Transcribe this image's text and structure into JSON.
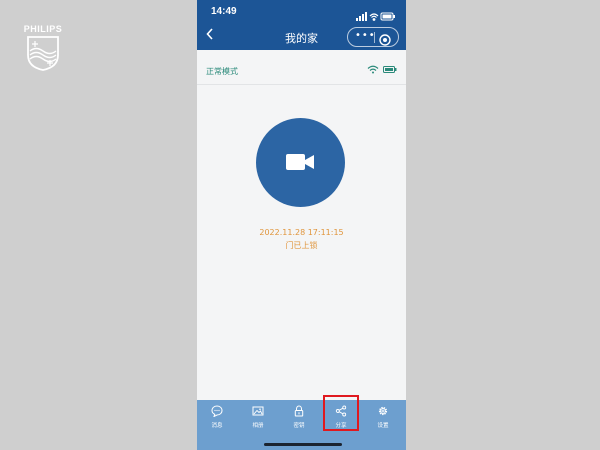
{
  "logo": {
    "text": "PHILIPS"
  },
  "status_bar": {
    "time": "14:49"
  },
  "nav": {
    "title": "我的家",
    "more": "•••"
  },
  "device": {
    "mode": "正常模式",
    "timestamp": "2022.11.28 17:11:15",
    "lock_status": "门已上锁"
  },
  "tabs": [
    {
      "label": "消息",
      "icon": "message-icon"
    },
    {
      "label": "相册",
      "icon": "image-icon"
    },
    {
      "label": "密钥",
      "icon": "lock-icon"
    },
    {
      "label": "分享",
      "icon": "share-icon"
    },
    {
      "label": "设置",
      "icon": "gear-icon"
    }
  ],
  "colors": {
    "header": "#1c5596",
    "tabbar": "#6d9fcf",
    "camera_button": "#2c65a4",
    "status_text": "#e0963e",
    "highlight": "#e0191f"
  }
}
